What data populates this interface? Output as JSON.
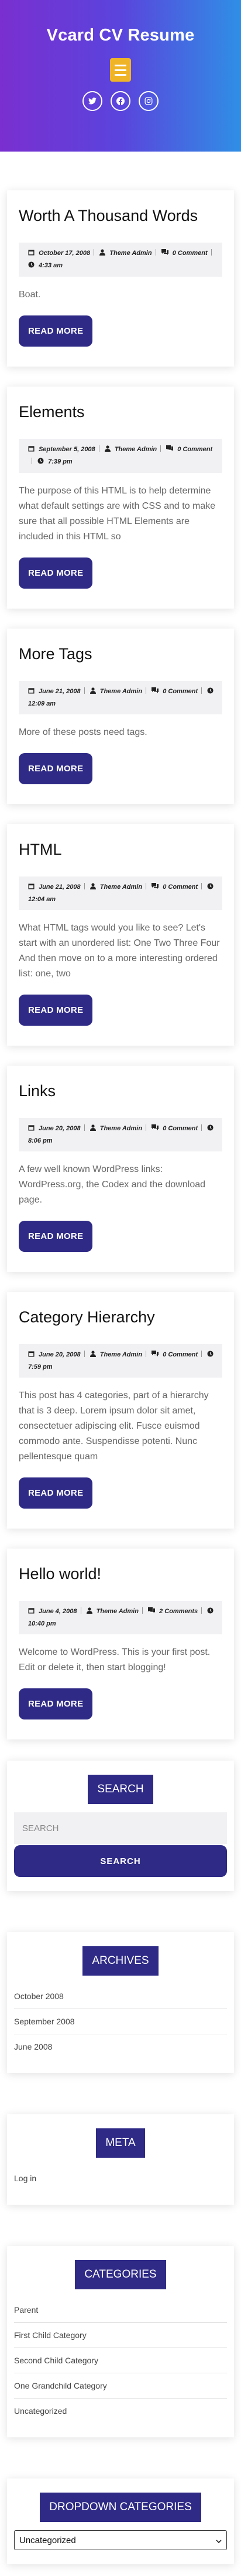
{
  "site": {
    "title": "Vcard CV Resume",
    "social": [
      "twitter-icon",
      "facebook-icon",
      "instagram-icon"
    ]
  },
  "colors": {
    "accent": "#2e2a86",
    "menu": "#f0b429",
    "header_start": "#7a2fd0",
    "header_end": "#2f8fe6"
  },
  "posts": [
    {
      "title": "Worth A Thousand Words",
      "date": "October 17, 2008",
      "author": "Theme Admin",
      "comments": "0",
      "comment_label": "Comment",
      "time": "4:33 am",
      "excerpt": "Boat.",
      "read_more": "READ MORE"
    },
    {
      "title": "Elements",
      "date": "September 5, 2008",
      "author": "Theme Admin",
      "comments": "0",
      "comment_label": "Comment",
      "time": "7:39 pm",
      "excerpt": "The purpose of this HTML is to help determine what default settings are with CSS and to make sure that all possible HTML Elements are included in this HTML so",
      "read_more": "READ MORE"
    },
    {
      "title": "More Tags",
      "date": "June 21, 2008",
      "author": "Theme Admin",
      "comments": "0",
      "comment_label": "Comment",
      "time": "12:09 am",
      "excerpt": "More of these posts need tags.",
      "read_more": "READ MORE"
    },
    {
      "title": "HTML",
      "date": "June 21, 2008",
      "author": "Theme Admin",
      "comments": "0",
      "comment_label": "Comment",
      "time": "12:04 am",
      "excerpt": "What HTML tags would you like to see? Let's start with an unordered list: One Two Three Four And then move on to a more interesting ordered list: one, two",
      "read_more": "READ MORE"
    },
    {
      "title": "Links",
      "date": "June 20, 2008",
      "author": "Theme Admin",
      "comments": "0",
      "comment_label": "Comment",
      "time": "8:06 pm",
      "excerpt": "A few well known WordPress links: WordPress.org, the Codex and the download page.",
      "read_more": "READ MORE"
    },
    {
      "title": "Category Hierarchy",
      "date": "June 20, 2008",
      "author": "Theme Admin",
      "comments": "0",
      "comment_label": "Comment",
      "time": "7:59 pm",
      "excerpt": "This post has 4 categories, part of a hierarchy that is 3 deep. Lorem ipsum dolor sit amet, consectetuer adipiscing elit. Fusce euismod commodo ante. Suspendisse potenti. Nunc pellentesque quam",
      "read_more": "READ MORE"
    },
    {
      "title": "Hello world!",
      "date": "June 4, 2008",
      "author": "Theme Admin",
      "comments": "2",
      "comment_label": "Comments",
      "time": "10:40 pm",
      "excerpt": "Welcome to WordPress. This is your first post. Edit or delete it, then start blogging!",
      "read_more": "READ MORE"
    }
  ],
  "search": {
    "title": "SEARCH",
    "placeholder": "SEARCH",
    "button": "SEARCH"
  },
  "archives": {
    "title": "ARCHIVES",
    "items": [
      "October 2008",
      "September 2008",
      "June 2008"
    ]
  },
  "meta_widget": {
    "title": "META",
    "items": [
      "Log in"
    ]
  },
  "categories": {
    "title": "CATEGORIES",
    "items": [
      "Parent",
      "First Child Category",
      "Second Child Category",
      "One Grandchild Category",
      "Uncategorized"
    ]
  },
  "dropdown_categories": {
    "title": "DROPDOWN CATEGORIES",
    "selected": "Uncategorized"
  }
}
